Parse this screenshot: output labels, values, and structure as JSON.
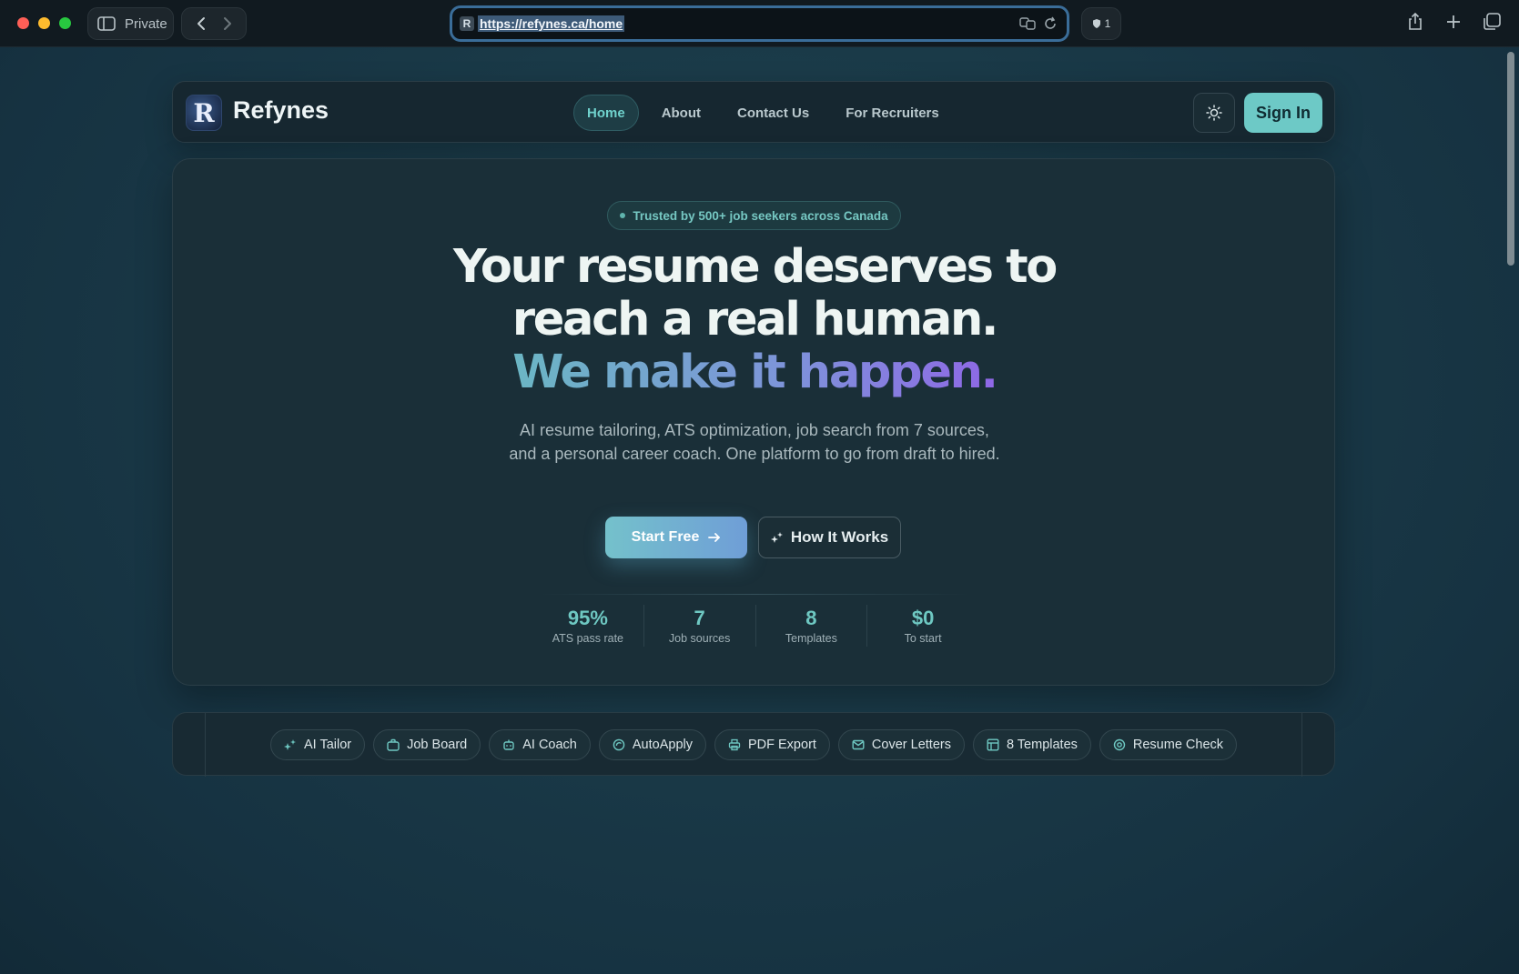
{
  "browser": {
    "private_label": "Private",
    "url": "https://refynes.ca/home",
    "favicon_letter": "R",
    "shield_count": "1"
  },
  "nav": {
    "logo_letter": "R",
    "brand": "Refynes",
    "links": [
      "Home",
      "About",
      "Contact Us",
      "For Recruiters"
    ],
    "active_link": "Home",
    "signin_label": "Sign In"
  },
  "hero": {
    "badge": "Trusted by 500+ job seekers across Canada",
    "headline_line1": "Your resume deserves to",
    "headline_line2": "reach a real human.",
    "headline_line3": "We make it happen.",
    "subtext": "AI resume tailoring, ATS optimization, job search from 7 sources, and a personal career coach. One platform to go from draft to hired.",
    "cta_primary": "Start Free",
    "cta_secondary": "How It Works",
    "stats": [
      {
        "value": "95%",
        "label": "ATS pass rate"
      },
      {
        "value": "7",
        "label": "Job sources"
      },
      {
        "value": "8",
        "label": "Templates"
      },
      {
        "value": "$0",
        "label": "To start"
      }
    ]
  },
  "features": [
    {
      "label": "AI Tailor",
      "icon": "sparkles-icon"
    },
    {
      "label": "Job Board",
      "icon": "briefcase-icon"
    },
    {
      "label": "AI Coach",
      "icon": "bot-icon"
    },
    {
      "label": "AutoApply",
      "icon": "auto-icon"
    },
    {
      "label": "PDF Export",
      "icon": "printer-icon"
    },
    {
      "label": "Cover Letters",
      "icon": "mail-icon"
    },
    {
      "label": "8 Templates",
      "icon": "layout-icon"
    },
    {
      "label": "Resume Check",
      "icon": "target-icon"
    }
  ],
  "colors": {
    "accent": "#6dc9c6",
    "gradient_start": "#6bb6c4",
    "gradient_end": "#8f67e6",
    "background": "#1a3a48"
  }
}
